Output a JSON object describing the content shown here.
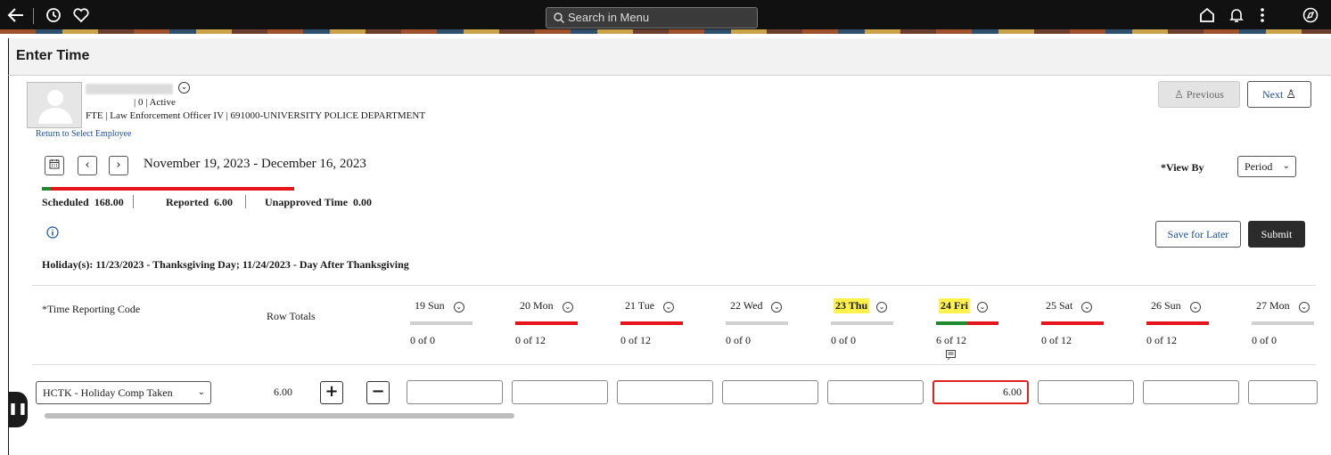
{
  "topbar": {
    "search_placeholder": "Search in Menu",
    "icons": [
      "back-arrow-icon",
      "history-icon",
      "favorites-icon",
      "home-icon",
      "notifications-icon",
      "more-vertical-icon",
      "navigator-icon"
    ]
  },
  "page": {
    "title": "Enter Time"
  },
  "employee": {
    "line1": "| 0 | Active",
    "line2": "FTE | Law Enforcement Officer IV | 691000-UNIVERSITY POLICE DEPARTMENT",
    "return_link": "Return to Select Employee"
  },
  "nav": {
    "previous_label": "Previous",
    "next_label": "Next"
  },
  "period": {
    "range": "November 19, 2023 - December 16, 2023",
    "view_by_label": "*View By",
    "view_by_value": "Period",
    "progress_fraction": 0.036
  },
  "summary": {
    "scheduled_label": "Scheduled",
    "scheduled_value": "168.00",
    "reported_label": "Reported",
    "reported_value": "6.00",
    "unapproved_label": "Unapproved Time",
    "unapproved_value": "0.00"
  },
  "actions": {
    "save_label": "Save for Later",
    "submit_label": "Submit"
  },
  "holiday_text": "Holiday(s): 11/23/2023 - Thanksgiving Day; 11/24/2023 - Day After Thanksgiving",
  "grid": {
    "trc_header": "*Time Reporting Code",
    "row_totals_header": "Row Totals",
    "days": [
      {
        "label": "19 Sun",
        "count": "0 of 0",
        "holiday": false,
        "bar": "grey",
        "reported_fraction": 0
      },
      {
        "label": "20 Mon",
        "count": "0 of 12",
        "holiday": false,
        "bar": "red",
        "reported_fraction": 0
      },
      {
        "label": "21 Tue",
        "count": "0 of 12",
        "holiday": false,
        "bar": "red",
        "reported_fraction": 0
      },
      {
        "label": "22 Wed",
        "count": "0 of 0",
        "holiday": false,
        "bar": "grey",
        "reported_fraction": 0
      },
      {
        "label": "23 Thu",
        "count": "0 of 0",
        "holiday": true,
        "bar": "grey",
        "reported_fraction": 0
      },
      {
        "label": "24 Fri",
        "count": "6 of 12",
        "holiday": true,
        "bar": "red",
        "reported_fraction": 0.5
      },
      {
        "label": "25 Sat",
        "count": "0 of 12",
        "holiday": false,
        "bar": "red",
        "reported_fraction": 0
      },
      {
        "label": "26 Sun",
        "count": "0 of 12",
        "holiday": false,
        "bar": "red",
        "reported_fraction": 0
      },
      {
        "label": "27 Mon",
        "count": "0 of 0",
        "holiday": false,
        "bar": "grey",
        "reported_fraction": 0
      }
    ],
    "row": {
      "trc_value": "HCTK - Holiday Comp Taken",
      "row_total": "6.00",
      "values": [
        "",
        "",
        "",
        "",
        "",
        "6.00",
        "",
        "",
        ""
      ]
    }
  },
  "colors": {
    "red": "#e8141b",
    "green": "#1e8a2e",
    "grey": "#d0d0d0",
    "highlight": "#fdf24c"
  }
}
